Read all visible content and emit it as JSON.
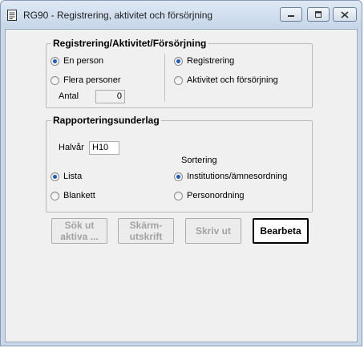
{
  "window": {
    "title": "RG90 - Registrering, aktivitet och försörjning",
    "controls": [
      "minimize-icon",
      "maximize-icon",
      "close-icon"
    ]
  },
  "group_registrering": {
    "legend": "Registrering/Aktivitet/Försörjning",
    "person_options": [
      {
        "label": "En person",
        "selected": true
      },
      {
        "label": "Flera personer",
        "selected": false
      }
    ],
    "antal_label": "Antal",
    "antal_value": "0",
    "type_options": [
      {
        "label": "Registrering",
        "selected": true
      },
      {
        "label": "Aktivitet och försörjning",
        "selected": false
      }
    ]
  },
  "group_rapport": {
    "legend": "Rapporteringsunderlag",
    "halvar_label": "Halvår",
    "halvar_value": "H10",
    "output_options": [
      {
        "label": "Lista",
        "selected": true
      },
      {
        "label": "Blankett",
        "selected": false
      }
    ],
    "sortering_label": "Sortering",
    "sort_options": [
      {
        "label": "Institutions/ämnesordning",
        "selected": true
      },
      {
        "label": "Personordning",
        "selected": false
      }
    ]
  },
  "buttons": {
    "sok": "Sök ut\naktiva ...",
    "skarm": "Skärm-\nutskrift",
    "skriv": "Skriv ut",
    "bearbeta": "Bearbeta"
  }
}
